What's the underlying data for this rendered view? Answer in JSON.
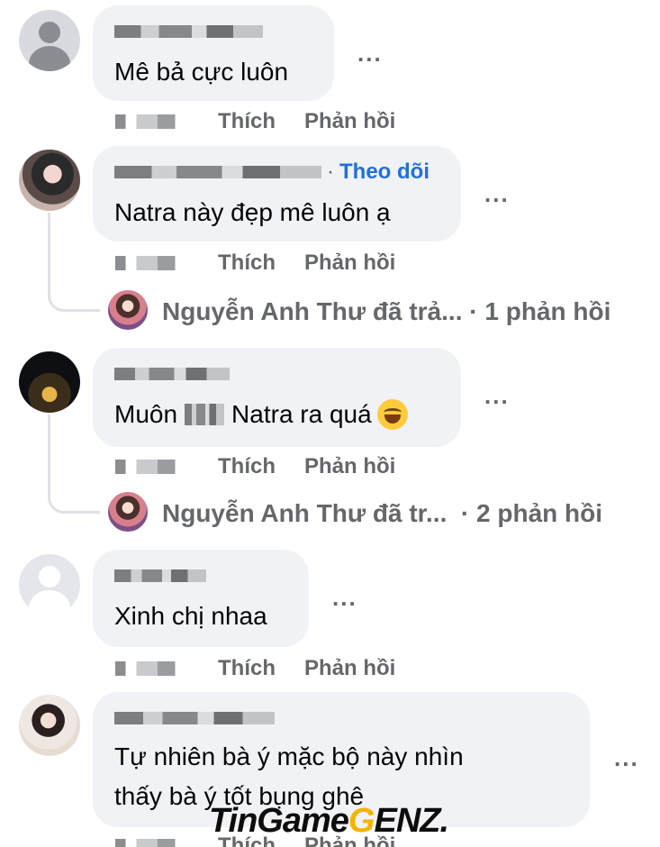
{
  "comments": [
    {
      "text": "Mê bả cực luôn",
      "like_label": "Thích",
      "reply_label": "Phản hồi",
      "more_label": "..."
    },
    {
      "follow_label": "Theo dõi",
      "text": "Natra này đẹp mê luôn ạ",
      "like_label": "Thích",
      "reply_label": "Phản hồi",
      "more_label": "...",
      "replies_summary": {
        "text": "Nguyễn Anh Thư đã trả...",
        "count": "· 1 phản hồi"
      }
    },
    {
      "text_prefix": "Muôn",
      "text_suffix": "Natra ra quá",
      "like_label": "Thích",
      "reply_label": "Phản hồi",
      "more_label": "...",
      "replies_summary": {
        "text": "Nguyễn Anh Thư đã tr...",
        "count": "· 2 phản hồi"
      }
    },
    {
      "text": "Xinh chị nhaa",
      "like_label": "Thích",
      "reply_label": "Phản hồi",
      "more_label": "..."
    },
    {
      "text_line1": "Tự nhiên bà ý mặc bộ này nhìn",
      "text_line2": "thấy bà ý tốt bụng ghê",
      "like_label": "Thích",
      "reply_label": "Phản hồi",
      "more_label": "..."
    }
  ],
  "icons": {
    "avatar": "person-silhouette-icon",
    "emoji": "grinning-face-icon",
    "more": "ellipsis-icon"
  },
  "colors": {
    "link": "#216fdb",
    "meta": "#65676b",
    "bubble": "#f0f2f5"
  },
  "watermark": {
    "part1": "TinGame",
    "part2": "G",
    "part3": "ENZ."
  }
}
